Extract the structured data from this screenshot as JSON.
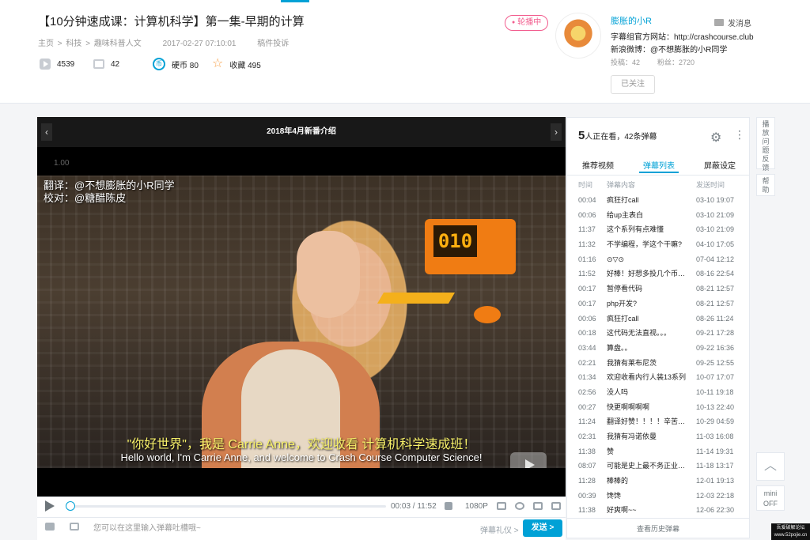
{
  "header": {
    "title": "【10分钟速成课：计算机科学】第一集-早期的计算",
    "breadcrumb": [
      "主页",
      ">",
      "科技",
      ">",
      "趣味科普人文"
    ],
    "date": "2017-02-27 07:10:01",
    "report": "稿件投诉",
    "stats": {
      "views": "4539",
      "danmaku": "42",
      "coin_label": "硬币 80",
      "collect_label": "收藏 495"
    }
  },
  "uploader": {
    "live_badge": "轮播中",
    "name": "膨胀的小R",
    "message": "发消息",
    "desc1": "字幕组官方网站：http://crashcourse.club",
    "desc2": "新浪微博：@不想膨胀的小R同学",
    "posts": "投稿：42",
    "fans": "粉丝：2720",
    "follow": "已关注"
  },
  "player": {
    "banner_title": "2018年4月新番介绍",
    "prev": "‹",
    "next": "›",
    "seek_value": "1.00",
    "credits_line1": "翻译：@不想膨胀的小R同学",
    "credits_line2": "校对：@糖醋陈皮",
    "screen_digits": "010",
    "subtitle_cn": "\"你好世界\"，我是 Carrie Anne，欢迎收看 计算机科学速成班！",
    "subtitle_en": "Hello world, I'm Carrie Anne, and welcome to Crash Course Computer Science!",
    "time": "00:03 / 11:52",
    "quality": "1080P",
    "progress": 0.004
  },
  "danmaku_bar": {
    "placeholder": "您可以在这里输入弹幕吐槽哦~",
    "etiquette": "弹幕礼仪 >",
    "send": "发送 >"
  },
  "sidebar": {
    "watching_count": "5",
    "watching_text": "人正在看，42条弹幕",
    "tabs": [
      "推荐视频",
      "弹幕列表",
      "屏蔽设定"
    ],
    "active_tab": 1,
    "columns": [
      "时间",
      "弹幕内容",
      "发送时间"
    ],
    "rows": [
      {
        "t": "00:04",
        "c": "疯狂打call",
        "d": "03-10 19:07"
      },
      {
        "t": "00:06",
        "c": "给up主表白",
        "d": "03-10 21:09"
      },
      {
        "t": "11:37",
        "c": "这个系列有点难懂",
        "d": "03-10 21:09"
      },
      {
        "t": "11:32",
        "c": "不学编程，学这个干嘛?",
        "d": "04-10 17:05"
      },
      {
        "t": "01:16",
        "c": "⊙▽⊙",
        "d": "07-04 12:12"
      },
      {
        "t": "11:52",
        "c": "好棒！好想多投几个币…",
        "d": "08-16 22:54"
      },
      {
        "t": "00:17",
        "c": "暂停看代码",
        "d": "08-21 12:57"
      },
      {
        "t": "00:17",
        "c": "php开发?",
        "d": "08-21 12:57"
      },
      {
        "t": "00:06",
        "c": "疯狂打call",
        "d": "08-26 11:24"
      },
      {
        "t": "00:18",
        "c": "这代码无法直视。。。",
        "d": "09-21 17:28"
      },
      {
        "t": "03:44",
        "c": "算盘。。",
        "d": "09-22 16:36"
      },
      {
        "t": "02:21",
        "c": "我猜有莱布尼茨",
        "d": "09-25 12:55"
      },
      {
        "t": "01:34",
        "c": "欢迎收看内行人装13系列",
        "d": "10-07 17:07"
      },
      {
        "t": "02:56",
        "c": "没人吗",
        "d": "10-11 19:18"
      },
      {
        "t": "00:27",
        "c": "快更啊啊啊啊",
        "d": "10-13 22:40"
      },
      {
        "t": "11:24",
        "c": "翻译好赞！！！！辛苦…",
        "d": "10-29 04:59"
      },
      {
        "t": "02:31",
        "c": "我猜有冯诺依曼",
        "d": "11-03 16:08"
      },
      {
        "t": "11:38",
        "c": "赞",
        "d": "11-14 19:31"
      },
      {
        "t": "08:07",
        "c": "可能是史上最不务正业…",
        "d": "11-18 13:17"
      },
      {
        "t": "11:28",
        "c": "棒棒的",
        "d": "12-01 19:13"
      },
      {
        "t": "00:39",
        "c": "馋馋",
        "d": "12-03 22:18"
      },
      {
        "t": "11:38",
        "c": "好爽啊~~",
        "d": "12-06 22:30"
      }
    ],
    "history": "查看历史弹幕"
  },
  "rail": {
    "feedback": "播放问题反馈",
    "help": "帮助",
    "up": "︿",
    "mini_line1": "mini",
    "mini_line2": "OFF"
  },
  "watermark": {
    "line1": "吾爱破解论坛",
    "line2": "www.52pojie.cn"
  }
}
